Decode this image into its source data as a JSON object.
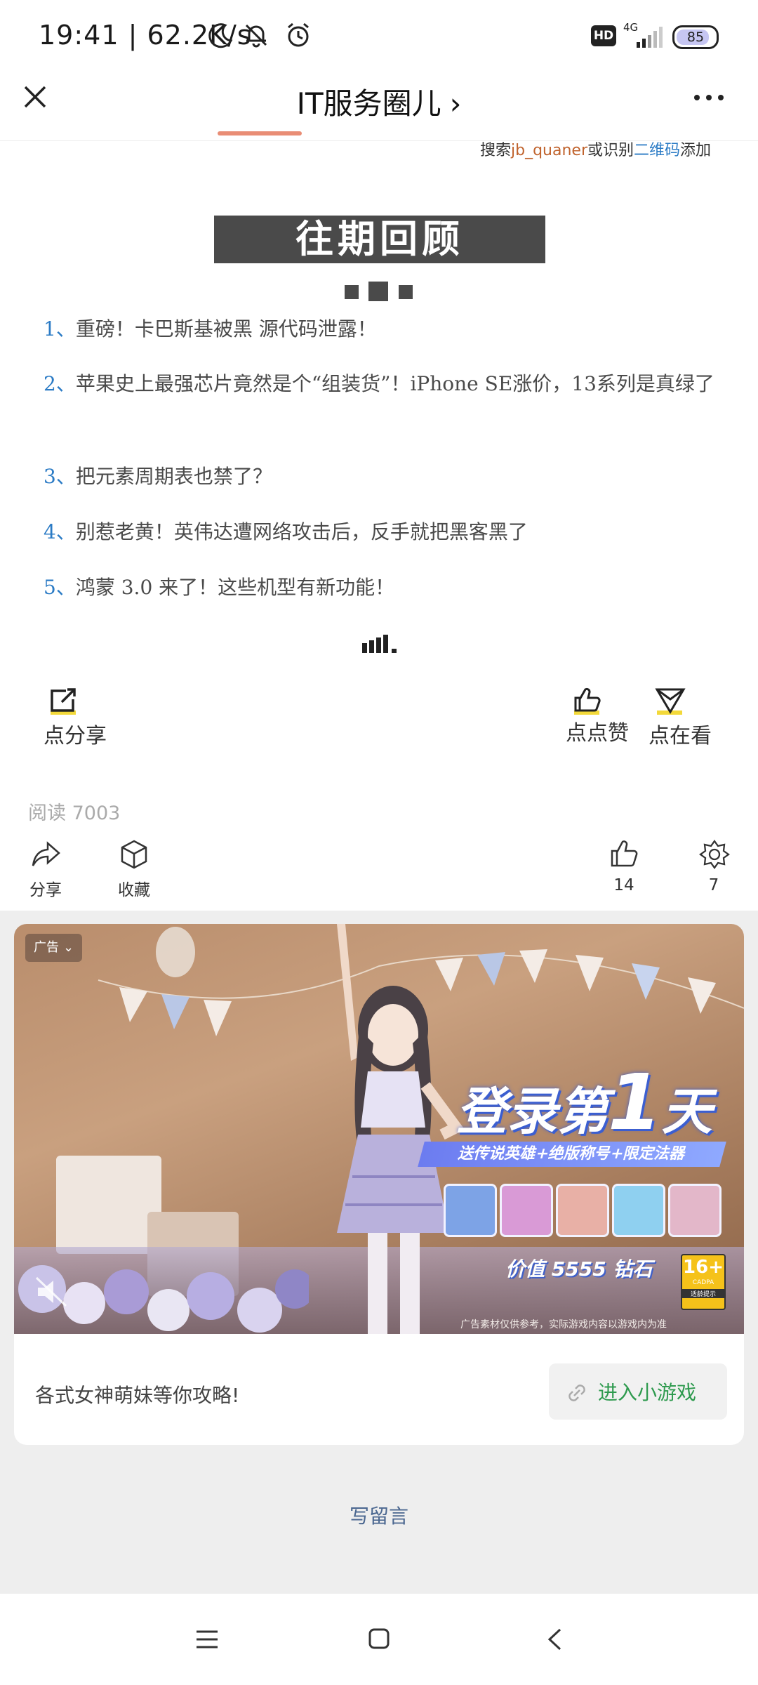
{
  "status_bar": {
    "time": "19:41 | 62.2K/s",
    "network_badge": "HD",
    "network_type": "4G",
    "battery": "85"
  },
  "header": {
    "title": "IT服务圈儿",
    "close_icon": "close-icon",
    "more_icon": "more-icon"
  },
  "article": {
    "top_fragment_prefix": "搜索",
    "top_fragment_id": "jb_quaner",
    "top_fragment_mid": "或识别",
    "top_fragment_qr": "二维码",
    "top_fragment_suffix": "添加",
    "review_title": "往期回顾",
    "review_items": [
      {
        "num": "1、",
        "text": "重磅！卡巴斯基被黑 源代码泄露！"
      },
      {
        "num": "2、",
        "text": "苹果史上最强芯片竟然是个“组装货”！iPhone SE涨价，13系列是真绿了"
      },
      {
        "num": "3、",
        "text": "把元素周期表也禁了？"
      },
      {
        "num": "4、",
        "text": "别惹老黄！英伟达遭网络攻击后，反手就把黑客黑了"
      },
      {
        "num": "5、",
        "text": "鸿蒙 3.0 来了！这些机型有新功能！"
      }
    ],
    "share_label": "点分享",
    "like_label": "点点赞",
    "watch_label": "点在看",
    "read_count": "阅读 7003"
  },
  "bottom_actions": {
    "share": "分享",
    "favorite": "收藏",
    "like_count": "14",
    "wow_count": "7"
  },
  "ad": {
    "tag": "广告",
    "headline_pre": "登录第",
    "headline_num": "1",
    "headline_post": "天",
    "sub_banner": "送传说英雄+绝版称号+限定法器",
    "value_text": "价值 5555 钻石",
    "age_rating": "16+",
    "age_org": "CADPA",
    "age_note": "适龄提示",
    "disclaimer": "广告素材仅供参考，实际游戏内容以游戏内为准",
    "description": "各式女神萌妹等你攻略!",
    "cta": "进入小游戏"
  },
  "comment": {
    "write_label": "写留言"
  },
  "colors": {
    "accent_blue": "#2b7bc5",
    "cta_green": "#2e9a4e",
    "banner_gray": "#4a4a4a"
  }
}
